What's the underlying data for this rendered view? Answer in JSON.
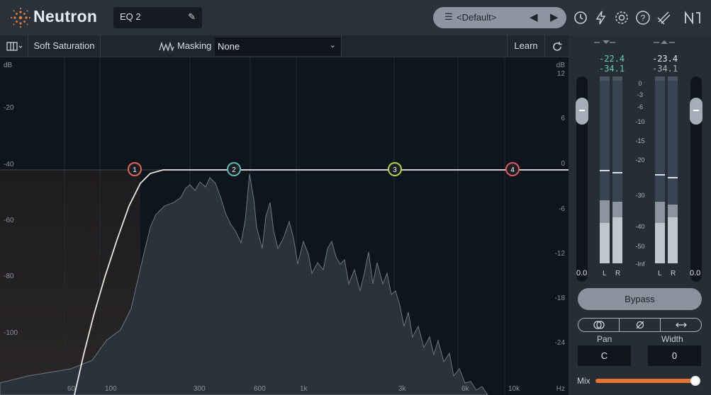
{
  "header": {
    "brand": "Neutron",
    "module_name": "EQ 2",
    "preset_name": "<Default>"
  },
  "toolbar": {
    "mode_label": "Soft Saturation",
    "masking_label": "Masking",
    "masking_value": "None",
    "learn_label": "Learn"
  },
  "eq": {
    "left_db_unit": "dB",
    "left_db_labels": [
      "-20",
      "-40",
      "-60",
      "-80",
      "-100"
    ],
    "right_db_unit": "dB",
    "right_db_labels": [
      "12",
      "6",
      "0",
      "-6",
      "-12",
      "-18",
      "-24"
    ],
    "freq_labels": [
      "60",
      "100",
      "300",
      "600",
      "1k",
      "3k",
      "6k",
      "10k"
    ],
    "freq_unit": "Hz",
    "nodes": [
      {
        "label": "1",
        "color": "#e0654c"
      },
      {
        "label": "2",
        "color": "#5fb7b3"
      },
      {
        "label": "3",
        "color": "#b3cf4a"
      },
      {
        "label": "4",
        "color": "#e0575e"
      }
    ]
  },
  "meters": {
    "in_peak": "-22.4",
    "in_rms": "-34.1",
    "out_peak": "-23.4",
    "out_rms": "-34.1",
    "scale": [
      "0",
      "-3",
      "-6",
      "-10",
      "-15",
      "-20",
      "-30",
      "-40",
      "-50",
      "-Inf"
    ],
    "in_gain": "0.0",
    "out_gain": "0.0",
    "channel_left": "L",
    "channel_right": "R",
    "peak_color": "#5fd0a7"
  },
  "controls": {
    "bypass_label": "Bypass",
    "pan_label": "Pan",
    "pan_value": "C",
    "width_label": "Width",
    "width_value": "0",
    "mix_label": "Mix",
    "mix_value": 0.97,
    "mix_color": "#e37331"
  }
}
